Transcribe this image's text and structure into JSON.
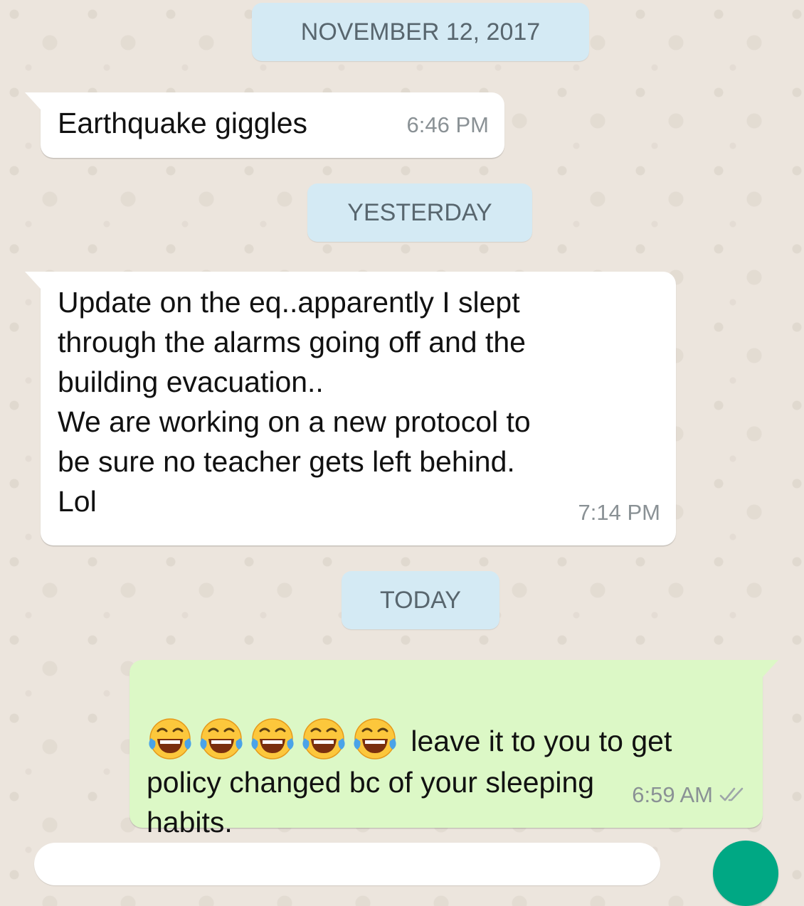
{
  "colors": {
    "chat_background": "#ece5dd",
    "incoming_bubble": "#ffffff",
    "outgoing_bubble": "#dcf8c6",
    "date_chip": "#d4eaf4",
    "timestamp_text": "#8a9195",
    "read_ticks": "#9ea5a9",
    "send_button": "#00a884"
  },
  "dates": {
    "first": "NOVEMBER 12, 2017",
    "second": "YESTERDAY",
    "third": "TODAY"
  },
  "messages": [
    {
      "direction": "incoming",
      "text": "Earthquake giggles",
      "time": "6:46 PM"
    },
    {
      "direction": "incoming",
      "text": "Update on the eq..apparently I slept\nthrough the alarms going off and the\nbuilding evacuation..\nWe are working on a new protocol to\nbe sure no teacher gets left behind.\nLol",
      "time": "7:14 PM"
    },
    {
      "direction": "outgoing",
      "emoji": [
        "face-with-tears-of-joy",
        "face-with-tears-of-joy",
        "face-with-tears-of-joy",
        "face-with-tears-of-joy",
        "face-with-tears-of-joy"
      ],
      "text": " leave it to you to get\npolicy changed  bc of your sleeping\nhabits.",
      "time": "6:59 AM",
      "status_icon": "double-check-icon"
    }
  ],
  "composer": {
    "placeholder": "",
    "send_icon": "send-icon"
  }
}
